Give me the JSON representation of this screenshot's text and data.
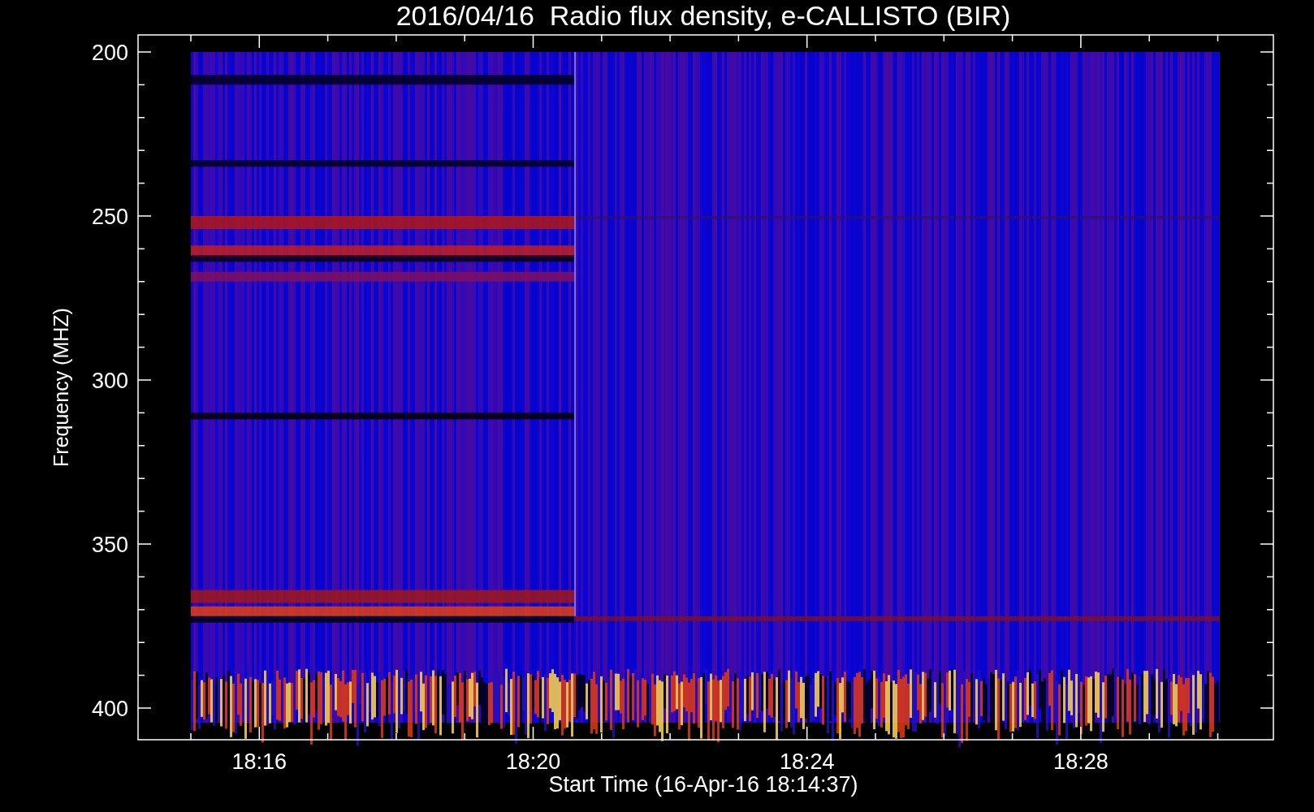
{
  "title": "2016/04/16  Radio flux density, e-CALLISTO (BIR)",
  "ylabel": "Frequency (MHZ)",
  "xlabel": "Start Time (16-Apr-16 18:14:37)",
  "yticks": [
    "200",
    "250",
    "300",
    "350",
    "400"
  ],
  "xticks": [
    "18:16",
    "18:20",
    "18:24",
    "18:28"
  ]
}
